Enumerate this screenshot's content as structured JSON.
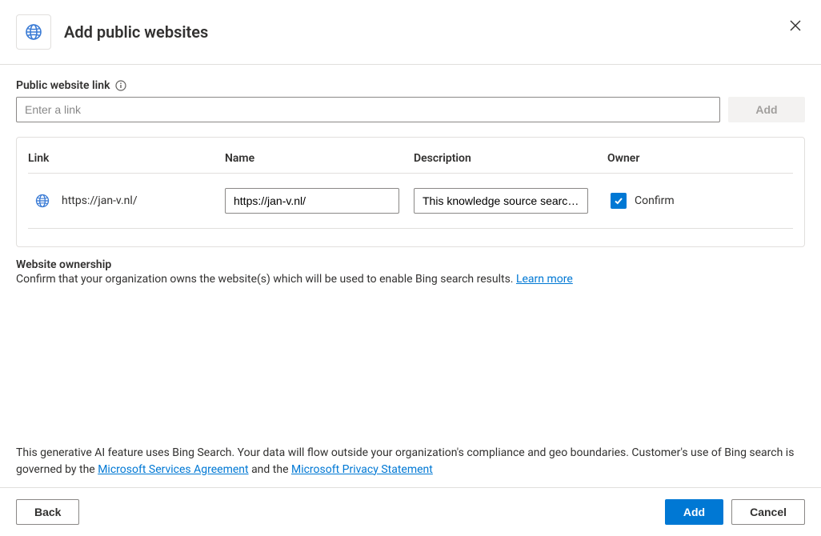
{
  "header": {
    "title": "Add public websites"
  },
  "link_field": {
    "label": "Public website link",
    "placeholder": "Enter a link",
    "add_button": "Add"
  },
  "table": {
    "columns": {
      "link": "Link",
      "name": "Name",
      "description": "Description",
      "owner": "Owner"
    },
    "rows": [
      {
        "link": "https://jan-v.nl/",
        "name": "https://jan-v.nl/",
        "description": "This knowledge source searches",
        "owner_confirmed": true,
        "owner_label": "Confirm"
      }
    ]
  },
  "ownership": {
    "title": "Website ownership",
    "description_pre": "Confirm that your organization owns the website(s) which will be used to enable Bing search results. ",
    "learn_more": "Learn more"
  },
  "disclosure": {
    "text_pre": "This generative AI feature uses Bing Search. Your data will flow outside your organization's compliance and geo boundaries. Customer's use of Bing search is governed by the ",
    "link1": "Microsoft Services Agreement",
    "mid": " and the ",
    "link2": "Microsoft Privacy Statement"
  },
  "footer": {
    "back": "Back",
    "add": "Add",
    "cancel": "Cancel"
  }
}
